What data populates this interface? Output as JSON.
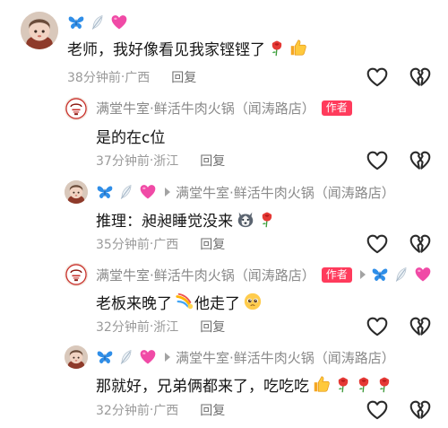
{
  "comments": [
    {
      "text": "老师，我好像看见我家铿铿了",
      "time": "38分钟前",
      "location": "广西",
      "reply_label": "回复"
    },
    {
      "author": "满堂牛室·鲜活牛肉火锅（闻涛路店）",
      "badge": "作者",
      "text": "是的在c位",
      "time": "37分钟前",
      "location": "浙江",
      "reply_label": "回复"
    },
    {
      "reply_to": "满堂牛室·鲜活牛肉火锅（闻涛路店）",
      "text": "推理：昶昶睡觉没来",
      "time": "35分钟前",
      "location": "广西",
      "reply_label": "回复"
    },
    {
      "author": "满堂牛室·鲜活牛肉火锅（闻涛路店）",
      "badge": "作者",
      "text": "老板来晚了",
      "text2": "他走了",
      "time": "32分钟前",
      "location": "浙江",
      "reply_label": "回复"
    },
    {
      "reply_to": "满堂牛室·鲜活牛肉火锅（闻涛路店）",
      "text": "那就好，兄弟俩都来了，吃吃吃",
      "time": "32分钟前",
      "location": "广西",
      "reply_label": "回复"
    }
  ],
  "separator": "·",
  "icons": {
    "like": "heart-outline-icon",
    "dislike": "broken-heart-icon",
    "butterfly": "butterfly-emoji",
    "feather": "feather-emoji",
    "pink_heart": "pink-heart-emoji",
    "rose": "rose-emoji",
    "thumbs_up": "thumbs-up-emoji",
    "husky": "husky-emoji",
    "comet": "comet-emoji",
    "pleading": "pleading-face-emoji"
  },
  "colors": {
    "badge": "#ff3b5c",
    "meta": "#9a9a9a",
    "text": "#161616"
  }
}
